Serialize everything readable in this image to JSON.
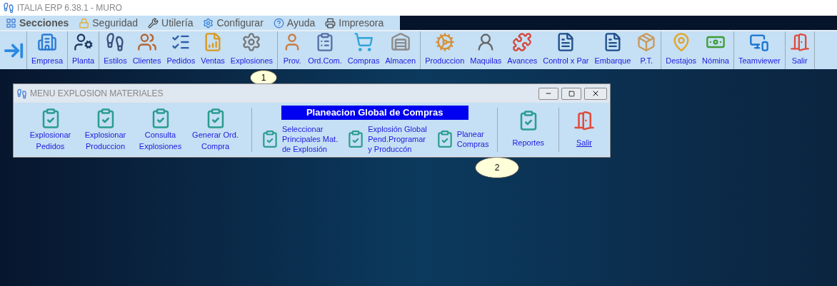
{
  "window": {
    "title": "ITALIA ERP 6.38.1 - MURO"
  },
  "menu_bar": [
    "Secciones",
    "Seguridad",
    "Utilería",
    "Configurar",
    "Ayuda",
    "Impresora"
  ],
  "toolbar": {
    "groups": [
      [
        "Empresa"
      ],
      [
        "Planta"
      ],
      [
        "Estilos",
        "Clientes",
        "Pedidos",
        "Ventas",
        "Explosiones"
      ],
      [
        "Prov.",
        "Ord.Com.",
        "Compras",
        "Almacen"
      ],
      [
        "Produccion",
        "Maquilas",
        "Avances",
        "Control x Par",
        "Embarque",
        "P.T."
      ],
      [
        "Destajos",
        "Nómina"
      ],
      [
        "Teamviewer"
      ],
      [
        "Salir"
      ]
    ]
  },
  "callouts": [
    "1",
    "2"
  ],
  "dialog": {
    "title": "MENU EXPLOSION MATERIALES",
    "items": [
      {
        "label": "Explosionar\nPedidos"
      },
      {
        "label": "Explosionar\nProduccion"
      },
      {
        "label": "Consulta\nExplosiones"
      },
      {
        "label": "Generar Ord.\nCompra"
      }
    ],
    "section": {
      "title": "Planeacion Global de Compras",
      "items": [
        {
          "label": "Seleccionar\nPrincipales Mat.\nde Explosión"
        },
        {
          "label": "Explosión Global\nPend.Programar\ny Produccón"
        },
        {
          "label": "Planear\nCompras"
        }
      ]
    },
    "reports": "Reportes",
    "exit_link": "Salir"
  }
}
